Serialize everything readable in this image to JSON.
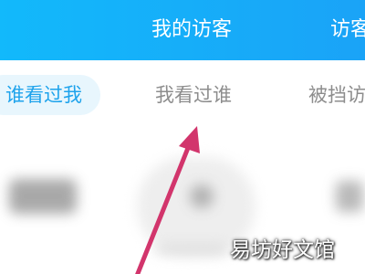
{
  "header": {
    "tabs": [
      {
        "label": "我的访客"
      },
      {
        "label": "访客"
      }
    ]
  },
  "subtabs": [
    {
      "label": "谁看过我",
      "active": true
    },
    {
      "label": "我看过谁",
      "active": false
    },
    {
      "label": "被挡访",
      "active": false
    }
  ],
  "annotation": {
    "type": "arrow",
    "color": "#d2356c",
    "points_to": "我看过谁"
  },
  "watermark": {
    "text": "易坊好文馆"
  },
  "colors": {
    "header": "#16b0f9",
    "active_tab": "#1ea3ec",
    "active_pill": "#e8f6fd",
    "inactive_tab": "#8d8d8d"
  }
}
